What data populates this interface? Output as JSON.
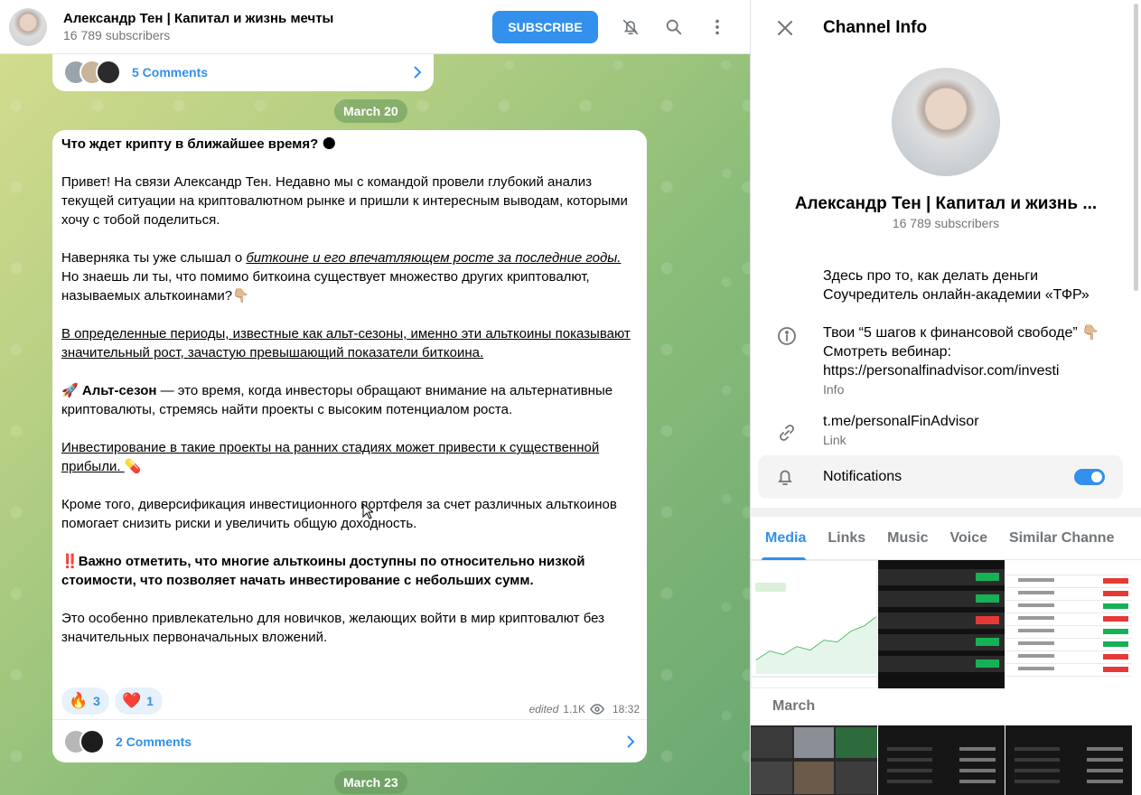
{
  "header": {
    "channel_name": "Александр Тен | Капитал и жизнь мечты",
    "subscribers": "16 789 subscribers",
    "subscribe_label": "SUBSCRIBE"
  },
  "prev_post": {
    "comments": "5 Comments"
  },
  "dates": {
    "first": "March 20",
    "second": "March 23"
  },
  "post": {
    "title": "Что ждет крипту в ближайшее время?",
    "p1": "Привет! На связи Александр Тен. Недавно мы с командой провели глубокий анализ текущей ситуации на криптовалютном рынке и пришли к интересным выводам, которыми хочу с тобой поделиться.",
    "p2a": "Наверняка ты уже слышал о ",
    "p2b": "биткоине и его впечатляющем росте за последние годы. ",
    "p2c": "Но знаешь ли ты, что помимо биткоина существует множество других криптовалют, называемых альткоинами?",
    "p3": "В определенные периоды, известные как альт-сезоны, именно эти альткоины показывают значительный рост, зачастую превышающий показатели биткоина.",
    "p4a": "Альт-сезон",
    "p4b": " — это время, когда инвесторы обращают внимание на альтернативные криптовалюты, стремясь найти проекты с высоким потенциалом роста.",
    "p5": "Инвестирование в такие проекты на ранних стадиях может привести к существенной прибыли. ",
    "p6": "Кроме того, диверсификация инвестиционного портфеля за счет различных альткоинов помогает снизить риски и увеличить общую доходность.",
    "p7": "Важно отметить, что многие альткоины доступны по относительно низкой стоимости, что позволяет начать инвестирование с небольших сумм.",
    "p8": "Это особенно привлекательно для новичков, желающих войти в мир криптовалют без значительных первоначальных вложений.",
    "reactions": [
      {
        "emoji": "🔥",
        "count": "3"
      },
      {
        "emoji": "❤️",
        "count": "1"
      }
    ],
    "edited": "edited",
    "views": "1.1K",
    "time": "18:32",
    "comments": "2 Comments"
  },
  "info": {
    "title": "Channel Info",
    "name": "Александр Тен | Капитал и жизнь ...",
    "subscribers": "16 789 subscribers",
    "desc1": "Здесь про то, как делать деньги",
    "desc2": "Соучредитель онлайн-академии «ТФР»",
    "webinar1": "Твои “5 шагов к финансовой свободе” 👇🏼",
    "webinar2": "Смотреть вебинар:",
    "webinar3": "https://personalfinadvisor.com/investi",
    "info_label": "Info",
    "link": "t.me/personalFinAdvisor",
    "link_label": "Link",
    "notifications": "Notifications",
    "tabs": [
      "Media",
      "Links",
      "Music",
      "Voice",
      "Similar Channe"
    ],
    "month": "March"
  },
  "colors": {
    "accent": "#3390ec",
    "secondary_text": "#707579"
  }
}
